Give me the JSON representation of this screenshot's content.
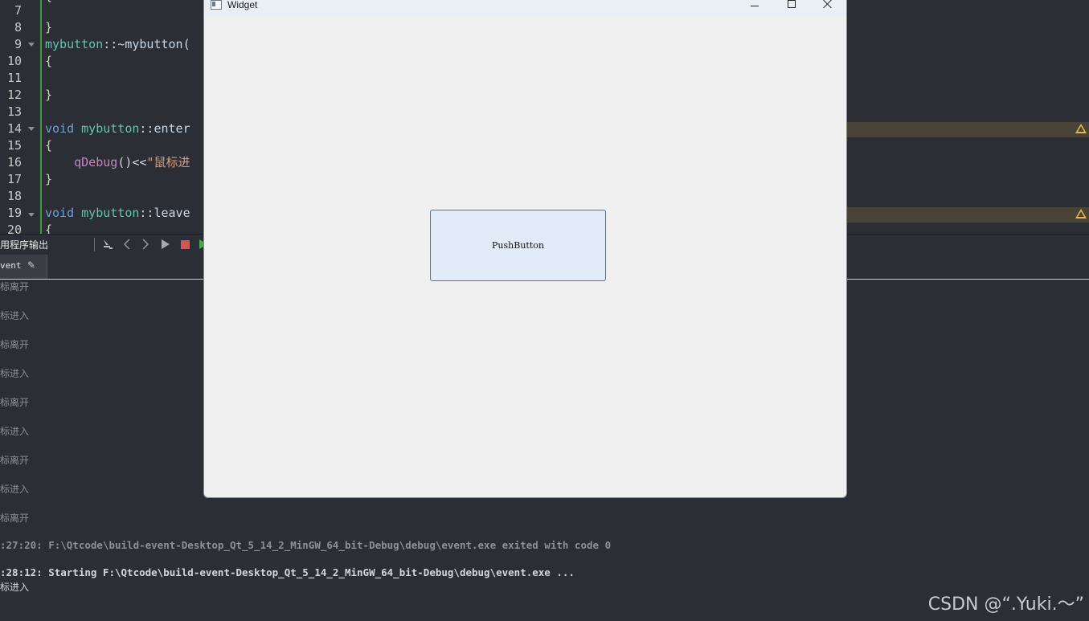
{
  "editor": {
    "lines": [
      {
        "no": "7",
        "fold": false,
        "warn": false
      },
      {
        "no": "8",
        "fold": false,
        "warn": false
      },
      {
        "no": "9",
        "fold": true,
        "warn": false
      },
      {
        "no": "10",
        "fold": false,
        "warn": false
      },
      {
        "no": "11",
        "fold": false,
        "warn": false
      },
      {
        "no": "12",
        "fold": false,
        "warn": false
      },
      {
        "no": "13",
        "fold": false,
        "warn": false
      },
      {
        "no": "14",
        "fold": true,
        "warn": true
      },
      {
        "no": "15",
        "fold": false,
        "warn": false
      },
      {
        "no": "16",
        "fold": false,
        "warn": false
      },
      {
        "no": "17",
        "fold": false,
        "warn": false
      },
      {
        "no": "18",
        "fold": false,
        "warn": false
      },
      {
        "no": "19",
        "fold": true,
        "warn": true
      },
      {
        "no": "20",
        "fold": false,
        "warn": false
      }
    ],
    "code": {
      "l7": "{",
      "l8": "}",
      "l9_class": "mybutton",
      "l9_sep": "::~",
      "l9_fn": "mybutton(",
      "l10": "{",
      "l12": "}",
      "l14_kw": "void",
      "l14_class": "mybutton",
      "l14_sep": "::",
      "l14_fn": "enter",
      "l15": "{",
      "l16_fn": "qDebug",
      "l16_paren": "()",
      "l16_op": "<<",
      "l16_str": "\"鼠标进",
      "l17": "}",
      "l19_kw": "void",
      "l19_class": "mybutton",
      "l19_sep": "::",
      "l19_fn": "leave",
      "l20": "{"
    }
  },
  "output_pane": {
    "title": "用程序输出",
    "tab_label": "vent"
  },
  "log": {
    "events": [
      "标离开",
      "标进入",
      "标离开",
      "标进入",
      "标离开",
      "标进入",
      "标离开",
      "标进入",
      "标离开"
    ],
    "exit_line": ":27:20: F:\\Qtcode\\build-event-Desktop_Qt_5_14_2_MinGW_64_bit-Debug\\debug\\event.exe exited with code 0",
    "start_line": ":28:12: Starting F:\\Qtcode\\build-event-Desktop_Qt_5_14_2_MinGW_64_bit-Debug\\debug\\event.exe ...",
    "last_event": "标进入"
  },
  "widget_window": {
    "title": "Widget",
    "button_label": "PushButton"
  },
  "watermark": "CSDN @“.Yuki.～”",
  "colors": {
    "editor_bg": "#2b2e34",
    "keyword": "#6ba0d6",
    "class_name": "#63c3b0",
    "string": "#d69d85",
    "warning": "#e6b84a",
    "button_border": "#2f7fd0",
    "button_bg": "#e1ecf8"
  },
  "icons": [
    "fold-arrow-icon",
    "warning-icon",
    "clear-icon",
    "prev-icon",
    "next-icon",
    "run-icon",
    "stop-icon",
    "rerun-icon",
    "pin-icon",
    "app-window-icon",
    "minimize-icon",
    "maximize-icon",
    "close-icon"
  ]
}
